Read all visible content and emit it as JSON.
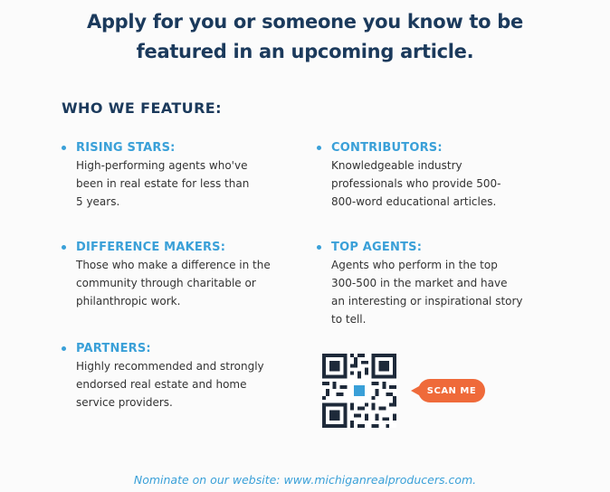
{
  "headline": {
    "line1": "Apply for you or someone you know to be",
    "line2": "featured in an upcoming article."
  },
  "section_title": "WHO WE FEATURE:",
  "features": {
    "rising_stars": {
      "title": "RISING STARS:",
      "desc_lines": [
        "High-performing agents who've",
        "been in real estate for less than",
        "5 years."
      ]
    },
    "contributors": {
      "title": "CONTRIBUTORS:",
      "desc_lines": [
        "Knowledgeable industry",
        "professionals who provide 500-",
        "800-word educational articles."
      ]
    },
    "difference_makers": {
      "title": "DIFFERENCE MAKERS:",
      "desc_lines": [
        "Those who make a difference in the",
        "community through charitable or",
        "philanthropic work."
      ]
    },
    "top_agents": {
      "title": "TOP AGENTS:",
      "desc_lines": [
        "Agents who perform in the top",
        "300-500 in the market and have",
        "an interesting or inspirational story",
        "to tell."
      ]
    },
    "partners": {
      "title": "PARTNERS:",
      "desc_lines": [
        "Highly recommended and strongly",
        "endorsed real estate and home",
        "service providers."
      ]
    }
  },
  "scan_label": "SCAN ME",
  "footer_text": "Nominate on our website: www.michiganrealproducers.com.",
  "colors": {
    "navy": "#1b3a5c",
    "accent_blue": "#3aa0d8",
    "orange": "#ef6a3a"
  }
}
